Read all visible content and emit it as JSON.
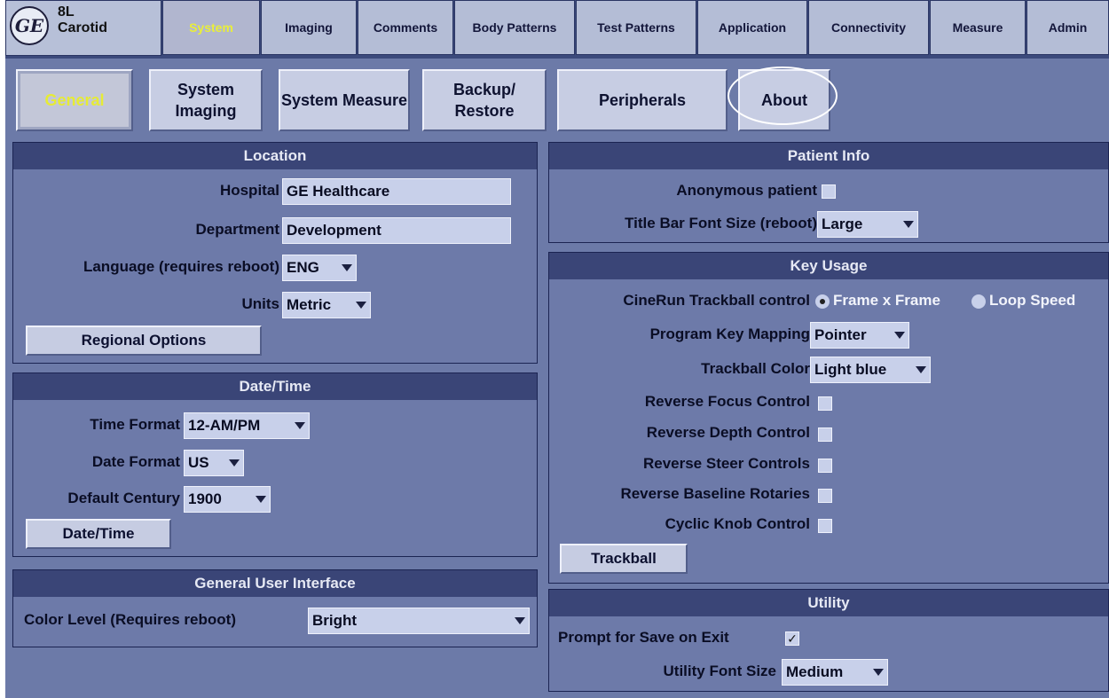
{
  "header": {
    "logo_icon": "ge-logo-icon",
    "logo_text": "GE",
    "probe_line1": "8L",
    "probe_line2": "Carotid",
    "tabs": [
      {
        "label": "System",
        "active": true
      },
      {
        "label": "Imaging"
      },
      {
        "label": "Comments"
      },
      {
        "label": "Body Patterns"
      },
      {
        "label": "Test Patterns"
      },
      {
        "label": "Application"
      },
      {
        "label": "Connectivity"
      },
      {
        "label": "Measure"
      },
      {
        "label": "Admin"
      }
    ]
  },
  "subtabs": [
    {
      "label": "General",
      "active": true
    },
    {
      "label": "System Imaging"
    },
    {
      "label": "System Measure"
    },
    {
      "label": "Backup/ Restore"
    },
    {
      "label": "Peripherals"
    },
    {
      "label": "About",
      "highlighted": true
    }
  ],
  "location": {
    "title": "Location",
    "hospital_label": "Hospital",
    "hospital_value": "GE Healthcare",
    "department_label": "Department",
    "department_value": "Development",
    "language_label": "Language (requires reboot)",
    "language_value": "ENG",
    "units_label": "Units",
    "units_value": "Metric",
    "regional_button": "Regional Options"
  },
  "datetime": {
    "title": "Date/Time",
    "time_format_label": "Time Format",
    "time_format_value": "12-AM/PM",
    "date_format_label": "Date Format",
    "date_format_value": "US",
    "century_label": "Default Century",
    "century_value": "1900",
    "datetime_button": "Date/Time"
  },
  "gui": {
    "title": "General User Interface",
    "color_level_label": "Color Level (Requires reboot)",
    "color_level_value": "Bright"
  },
  "patient": {
    "title": "Patient Info",
    "anonymous_label": "Anonymous patient",
    "anonymous_checked": false,
    "title_font_label": "Title Bar Font Size (reboot)",
    "title_font_value": "Large"
  },
  "keyusage": {
    "title": "Key Usage",
    "cinerun_label": "CineRun Trackball control",
    "cinerun_opt1": "Frame x Frame",
    "cinerun_opt2": "Loop Speed",
    "cinerun_selected": "Frame x Frame",
    "program_key_label": "Program Key Mapping",
    "program_key_value": "Pointer",
    "trackball_color_label": "Trackball Color",
    "trackball_color_value": "Light blue",
    "reverse_focus_label": "Reverse Focus Control",
    "reverse_depth_label": "Reverse Depth Control",
    "reverse_steer_label": "Reverse Steer Controls",
    "reverse_baseline_label": "Reverse Baseline Rotaries",
    "cyclic_knob_label": "Cyclic Knob Control",
    "trackball_button": "Trackball"
  },
  "utility": {
    "title": "Utility",
    "prompt_save_label": "Prompt for Save on Exit",
    "prompt_save_checked": true,
    "prompt_save_mark": "✓",
    "font_size_label": "Utility Font Size",
    "font_size_value": "Medium"
  },
  "colors": {
    "background": "#6c7aa8",
    "header_bar": "#3a4577",
    "active_tab_text": "#e9ee3a"
  }
}
